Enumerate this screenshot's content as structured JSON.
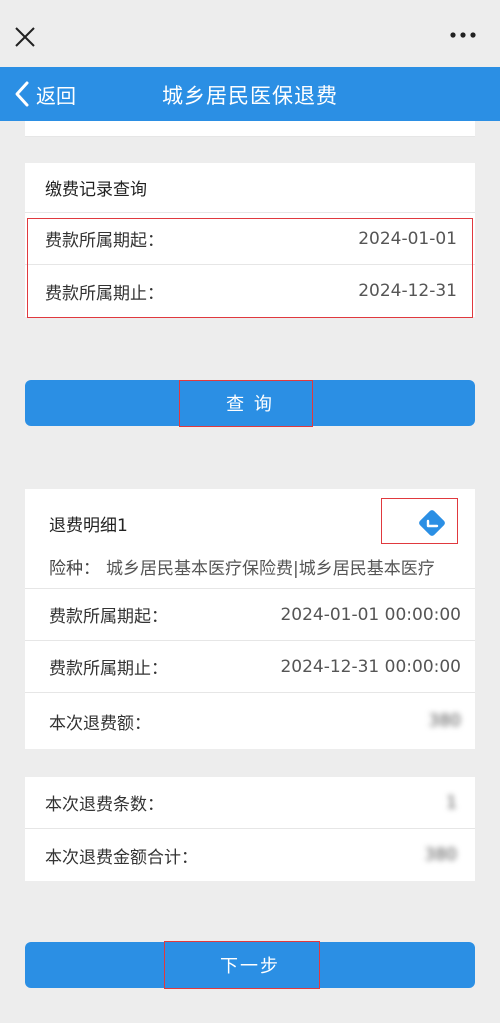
{
  "nav": {
    "back_label": "返回",
    "title": "城乡居民医保退费"
  },
  "query_card": {
    "header": "缴费记录查询",
    "rows": [
      {
        "label": "费款所属期起：",
        "value": "2024-01-01"
      },
      {
        "label": "费款所属期止：",
        "value": "2024-12-31"
      }
    ]
  },
  "query_button": "查 询",
  "detail_card": {
    "header": "退费明细1",
    "insurance_label": "险种：",
    "insurance_value": "城乡居民基本医疗保险费|城乡居民基本医疗",
    "rows": [
      {
        "label": "费款所属期起：",
        "value": "2024-01-01 00:00:00"
      },
      {
        "label": "费款所属期止：",
        "value": "2024-12-31 00:00:00"
      },
      {
        "label": "本次退费额：",
        "value": "380"
      }
    ]
  },
  "summary_card": {
    "rows": [
      {
        "label": "本次退费条数：",
        "value": "1"
      },
      {
        "label": "本次退费金额合计：",
        "value": "380"
      }
    ]
  },
  "next_button": "下一步",
  "colors": {
    "primary": "#2b8fe4",
    "highlight_box": "#e0393e",
    "background": "#ededed"
  },
  "icons": {
    "close": "close-icon",
    "more": "more-dots-icon",
    "back": "chevron-left-icon",
    "collapse": "collapse-diamond-icon"
  }
}
